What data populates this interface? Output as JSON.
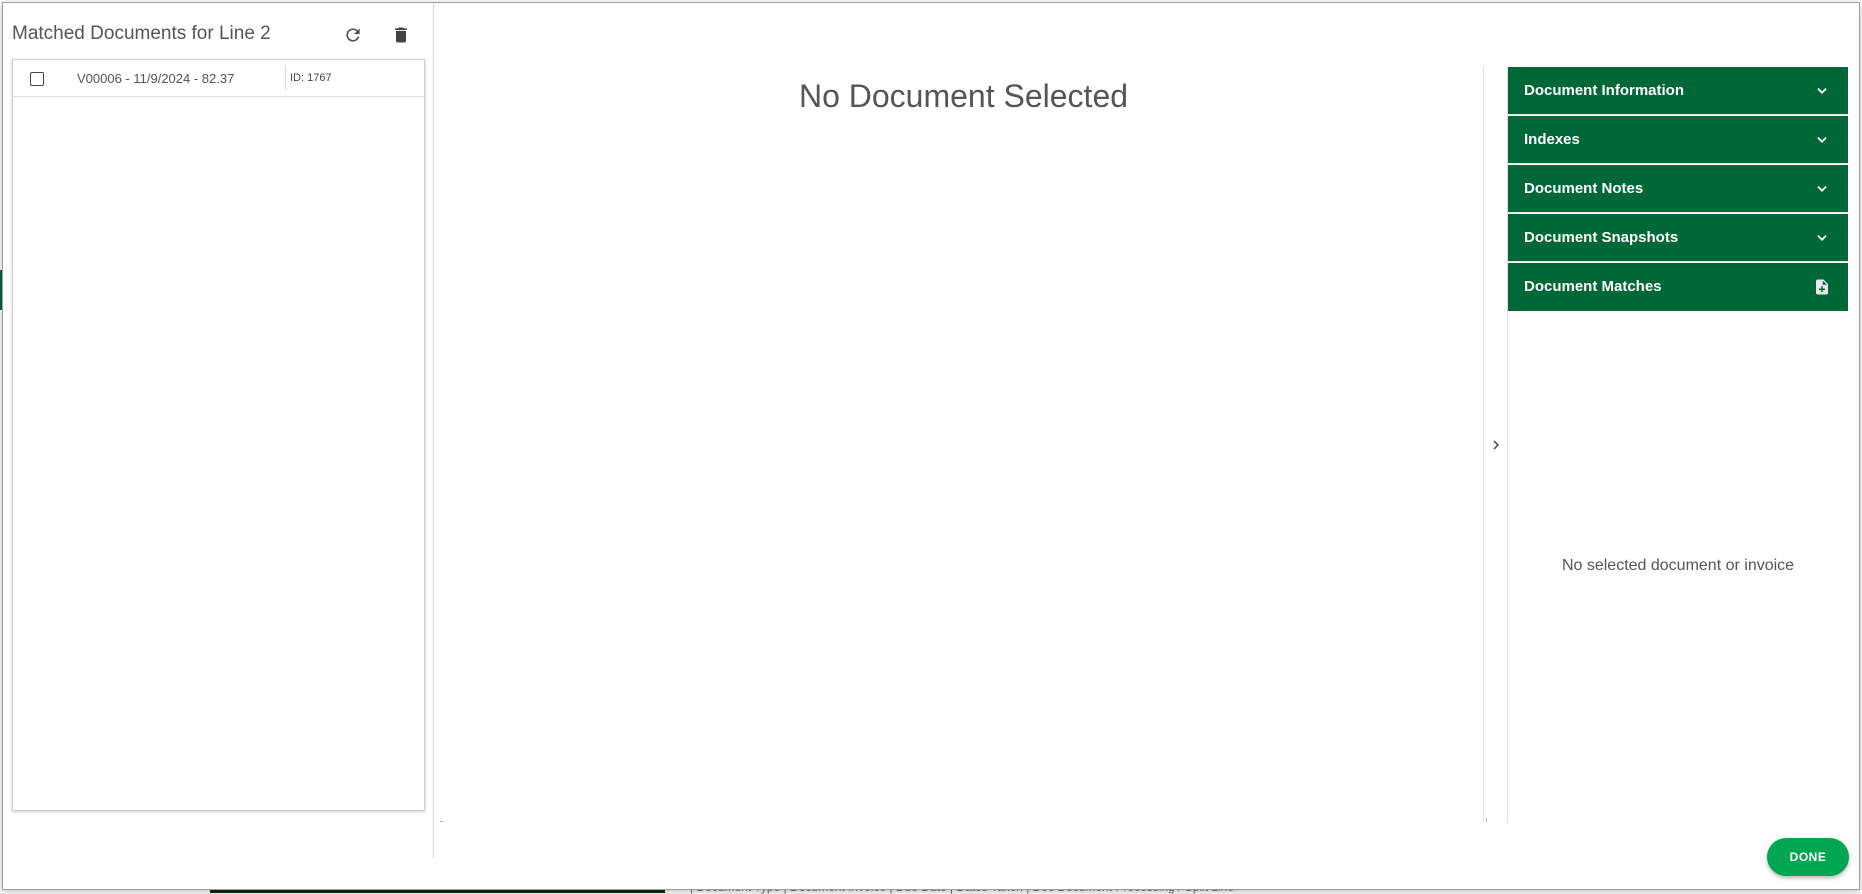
{
  "background": {
    "footer_text": "| Document Type | Document Invoice | Due Date | Dates Taken | Doc Document Processing / Split Line"
  },
  "left_panel": {
    "title": "Matched Documents for Line 2",
    "refresh_icon": "refresh-icon",
    "delete_icon": "trash-icon",
    "documents": [
      {
        "label": "V00006 - 11/9/2024 - 82.37",
        "id": "ID: 1767",
        "checked": false
      }
    ]
  },
  "viewer": {
    "title": "No Document Selected"
  },
  "side_panel": {
    "sections": [
      {
        "label": "Document Information",
        "icon": "chevron-down-icon"
      },
      {
        "label": "Indexes",
        "icon": "chevron-down-icon"
      },
      {
        "label": "Document Notes",
        "icon": "chevron-down-icon"
      },
      {
        "label": "Document Snapshots",
        "icon": "chevron-down-icon"
      },
      {
        "label": "Document Matches",
        "icon": "add-document-icon"
      }
    ],
    "empty_message": "No selected document or invoice"
  },
  "footer": {
    "done_label": "DONE"
  },
  "colors": {
    "accent_green": "#006837",
    "button_green": "#00a651",
    "text_gray": "#555555"
  }
}
